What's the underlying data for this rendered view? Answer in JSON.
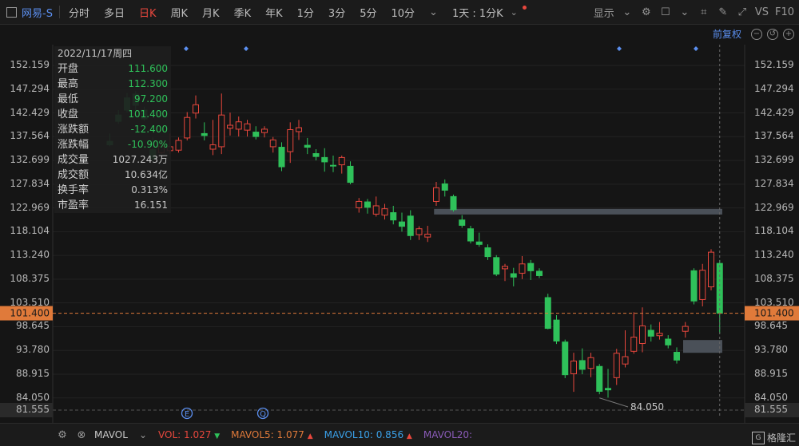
{
  "toolbar": {
    "stock_name": "网易-S",
    "periods": [
      "分时",
      "多日",
      "日K",
      "周K",
      "月K",
      "季K",
      "年K",
      "1分",
      "3分",
      "5分",
      "10分"
    ],
    "active_period": "日K",
    "range_selector": "1天 : 1分K",
    "display_label": "显示",
    "vs_label": "VS",
    "f10_label": "F10"
  },
  "subbar": {
    "adjust_label": "前复权"
  },
  "info_panel": {
    "date": "2022/11/17周四",
    "rows": [
      {
        "label": "开盘",
        "value": "111.600",
        "color": "green"
      },
      {
        "label": "最高",
        "value": "112.300",
        "color": "green"
      },
      {
        "label": "最低",
        "value": "97.200",
        "color": "green"
      },
      {
        "label": "收盘",
        "value": "101.400",
        "color": "green"
      },
      {
        "label": "涨跌额",
        "value": "-12.400",
        "color": "green"
      },
      {
        "label": "涨跌幅",
        "value": "-10.90%",
        "color": "green"
      },
      {
        "label": "成交量",
        "value": "1027.243万",
        "color": "plain"
      },
      {
        "label": "成交额",
        "value": "10.634亿",
        "color": "plain"
      },
      {
        "label": "换手率",
        "value": "0.313%",
        "color": "plain"
      },
      {
        "label": "市盈率",
        "value": "16.151",
        "color": "plain"
      }
    ]
  },
  "axis": {
    "left_ticks": [
      "152.159",
      "147.294",
      "142.429",
      "137.564",
      "132.699",
      "127.834",
      "122.969",
      "118.104",
      "113.240",
      "108.375",
      "103.510",
      "98.645",
      "93.780",
      "88.915",
      "84.050",
      "81.555"
    ],
    "right_ticks": [
      "152.159",
      "147.294",
      "142.429",
      "137.564",
      "132.699",
      "127.834",
      "122.969",
      "118.104",
      "113.240",
      "108.375",
      "103.510",
      "98.645",
      "93.780",
      "88.915",
      "84.050",
      "81.555"
    ],
    "last_price": "101.400"
  },
  "markers": {
    "e": "E",
    "q": "Q"
  },
  "volume_legend": {
    "mavol": "MAVOL",
    "vol_label": "VOL:",
    "vol_value": "1.027",
    "mavol5_label": "MAVOL5:",
    "mavol5_value": "1.077",
    "mavol10_label": "MAVOL10:",
    "mavol10_value": "0.856",
    "mavol20_label": "MAVOL20:"
  },
  "watermark": "格隆汇",
  "colors": {
    "up": "#e8473d",
    "down": "#2fc15a",
    "accent": "#5b8ff0",
    "price_line": "#e07a3a"
  },
  "chart_data": {
    "type": "candlestick",
    "y_min": 81.555,
    "y_max": 152.159,
    "min_label": "84.050",
    "candles": [
      {
        "o": 136.6,
        "h": 138.2,
        "l": 135.6,
        "c": 135.9
      },
      {
        "o": 142.0,
        "h": 143.0,
        "l": 140.2,
        "c": 140.7
      },
      {
        "o": 145.5,
        "h": 146.5,
        "l": 142.5,
        "c": 143.0
      },
      {
        "o": 146.3,
        "h": 146.9,
        "l": 143.0,
        "c": 144.0
      },
      {
        "o": 143.0,
        "h": 143.7,
        "l": 140.8,
        "c": 141.2
      },
      {
        "o": 134.9,
        "h": 137.4,
        "l": 132.5,
        "c": 133.0
      },
      {
        "o": 134.3,
        "h": 136.8,
        "l": 134.0,
        "c": 135.6
      },
      {
        "o": 134.7,
        "h": 138.2,
        "l": 134.0,
        "c": 135.5
      },
      {
        "o": 134.8,
        "h": 137.4,
        "l": 134.3,
        "c": 136.8
      },
      {
        "o": 137.3,
        "h": 142.6,
        "l": 136.8,
        "c": 141.5
      },
      {
        "o": 142.4,
        "h": 146.0,
        "l": 141.3,
        "c": 144.1
      },
      {
        "o": 138.2,
        "h": 140.5,
        "l": 136.8,
        "c": 137.8
      },
      {
        "o": 135.0,
        "h": 141.0,
        "l": 133.8,
        "c": 135.9
      },
      {
        "o": 135.5,
        "h": 146.4,
        "l": 134.0,
        "c": 142.0
      },
      {
        "o": 139.3,
        "h": 142.5,
        "l": 137.8,
        "c": 139.9
      },
      {
        "o": 139.1,
        "h": 141.7,
        "l": 137.6,
        "c": 140.6
      },
      {
        "o": 138.9,
        "h": 141.0,
        "l": 137.6,
        "c": 140.2
      },
      {
        "o": 138.5,
        "h": 139.7,
        "l": 137.0,
        "c": 137.6
      },
      {
        "o": 138.4,
        "h": 139.7,
        "l": 137.4,
        "c": 139.1
      },
      {
        "o": 135.5,
        "h": 137.5,
        "l": 134.3,
        "c": 136.9
      },
      {
        "o": 135.4,
        "h": 136.4,
        "l": 130.5,
        "c": 131.4
      },
      {
        "o": 134.5,
        "h": 140.5,
        "l": 132.2,
        "c": 139.0
      },
      {
        "o": 138.6,
        "h": 141.0,
        "l": 136.9,
        "c": 139.4
      },
      {
        "o": 135.8,
        "h": 137.3,
        "l": 134.0,
        "c": 135.4
      },
      {
        "o": 134.1,
        "h": 135.0,
        "l": 132.7,
        "c": 133.5
      },
      {
        "o": 133.3,
        "h": 135.2,
        "l": 130.4,
        "c": 132.4
      },
      {
        "o": 131.7,
        "h": 133.7,
        "l": 130.3,
        "c": 131.6
      },
      {
        "o": 131.8,
        "h": 133.7,
        "l": 130.0,
        "c": 133.3
      },
      {
        "o": 131.5,
        "h": 132.5,
        "l": 127.8,
        "c": 128.2
      },
      {
        "o": 123.0,
        "h": 125.0,
        "l": 122.0,
        "c": 124.3
      },
      {
        "o": 124.2,
        "h": 124.8,
        "l": 121.8,
        "c": 123.1
      },
      {
        "o": 121.7,
        "h": 125.3,
        "l": 121.2,
        "c": 123.4
      },
      {
        "o": 121.5,
        "h": 123.8,
        "l": 120.6,
        "c": 122.8
      },
      {
        "o": 122.0,
        "h": 123.4,
        "l": 119.6,
        "c": 120.5
      },
      {
        "o": 120.1,
        "h": 122.0,
        "l": 118.1,
        "c": 119.2
      },
      {
        "o": 121.3,
        "h": 122.5,
        "l": 116.4,
        "c": 117.3
      },
      {
        "o": 117.5,
        "h": 119.2,
        "l": 116.4,
        "c": 118.7
      },
      {
        "o": 117.0,
        "h": 119.3,
        "l": 116.0,
        "c": 117.6
      },
      {
        "o": 124.3,
        "h": 128.3,
        "l": 123.4,
        "c": 127.1
      },
      {
        "o": 127.9,
        "h": 128.8,
        "l": 125.3,
        "c": 126.6
      },
      {
        "o": 125.3,
        "h": 125.7,
        "l": 122.2,
        "c": 122.6
      },
      {
        "o": 120.5,
        "h": 121.5,
        "l": 118.9,
        "c": 119.4
      },
      {
        "o": 118.7,
        "h": 119.3,
        "l": 115.7,
        "c": 116.2
      },
      {
        "o": 116.0,
        "h": 117.9,
        "l": 115.0,
        "c": 115.5
      },
      {
        "o": 114.8,
        "h": 115.5,
        "l": 112.3,
        "c": 113.0
      },
      {
        "o": 112.8,
        "h": 113.3,
        "l": 109.0,
        "c": 109.4
      },
      {
        "o": 110.5,
        "h": 111.5,
        "l": 108.0,
        "c": 111.0
      },
      {
        "o": 109.5,
        "h": 110.7,
        "l": 106.9,
        "c": 108.8
      },
      {
        "o": 109.6,
        "h": 113.1,
        "l": 108.4,
        "c": 111.5
      },
      {
        "o": 111.6,
        "h": 112.3,
        "l": 108.2,
        "c": 110.1
      },
      {
        "o": 110.0,
        "h": 110.6,
        "l": 108.6,
        "c": 109.1
      },
      {
        "o": 104.6,
        "h": 105.4,
        "l": 98.1,
        "c": 98.3
      },
      {
        "o": 100.0,
        "h": 101.0,
        "l": 95.1,
        "c": 95.7
      },
      {
        "o": 95.5,
        "h": 96.0,
        "l": 88.1,
        "c": 88.8
      },
      {
        "o": 89.0,
        "h": 93.3,
        "l": 85.3,
        "c": 91.6
      },
      {
        "o": 91.7,
        "h": 94.2,
        "l": 88.9,
        "c": 89.9
      },
      {
        "o": 90.1,
        "h": 93.3,
        "l": 88.3,
        "c": 92.3
      },
      {
        "o": 90.5,
        "h": 91.0,
        "l": 84.8,
        "c": 85.4
      },
      {
        "o": 86.0,
        "h": 90.0,
        "l": 84.1,
        "c": 85.7
      },
      {
        "o": 88.2,
        "h": 94.1,
        "l": 86.7,
        "c": 93.2
      },
      {
        "o": 91.0,
        "h": 97.9,
        "l": 90.3,
        "c": 92.5
      },
      {
        "o": 93.6,
        "h": 101.6,
        "l": 93.1,
        "c": 96.5
      },
      {
        "o": 95.2,
        "h": 102.6,
        "l": 93.4,
        "c": 98.8
      },
      {
        "o": 97.9,
        "h": 99.1,
        "l": 95.6,
        "c": 96.7
      },
      {
        "o": 96.8,
        "h": 99.6,
        "l": 96.0,
        "c": 97.3
      },
      {
        "o": 96.1,
        "h": 96.9,
        "l": 94.2,
        "c": 94.9
      },
      {
        "o": 93.4,
        "h": 94.4,
        "l": 91.1,
        "c": 91.8
      },
      {
        "o": 97.7,
        "h": 99.6,
        "l": 96.4,
        "c": 98.7
      },
      {
        "o": 110.1,
        "h": 110.6,
        "l": 103.2,
        "c": 103.9
      },
      {
        "o": 104.2,
        "h": 111.5,
        "l": 102.8,
        "c": 110.2
      },
      {
        "o": 106.8,
        "h": 114.5,
        "l": 106.1,
        "c": 113.9
      },
      {
        "o": 111.6,
        "h": 112.3,
        "l": 97.2,
        "c": 101.4
      }
    ],
    "gap_bands": [
      {
        "from_index": 37,
        "y": 122.2
      },
      {
        "from_index": 66,
        "y": 94.6
      }
    ]
  }
}
